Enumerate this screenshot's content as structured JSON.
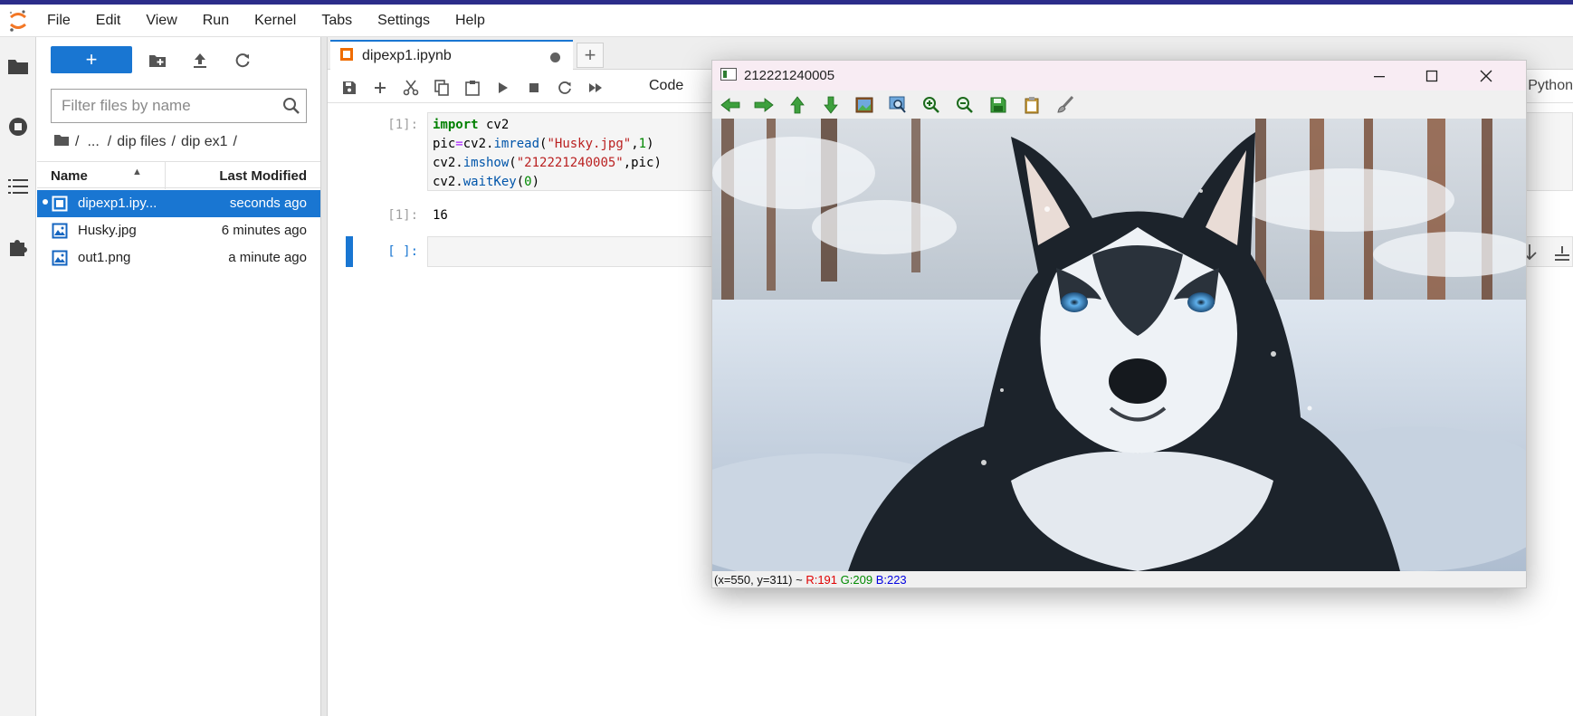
{
  "menu": [
    "File",
    "Edit",
    "View",
    "Run",
    "Kernel",
    "Tabs",
    "Settings",
    "Help"
  ],
  "filebrowser": {
    "new_label": "+",
    "filter_placeholder": "Filter files by name",
    "breadcrumb": [
      "/",
      "...",
      "/",
      "dip files",
      "/",
      "dip ex1",
      "/"
    ],
    "columns": {
      "name": "Name",
      "modified": "Last Modified"
    },
    "files": [
      {
        "name": "dipexp1.ipynb",
        "display": "dipexp1.ipy...",
        "modified": "seconds ago",
        "selected": true,
        "icon": "notebook-icon"
      },
      {
        "name": "Husky.jpg",
        "display": "Husky.jpg",
        "modified": "6 minutes ago",
        "selected": false,
        "icon": "image-file-icon"
      },
      {
        "name": "out1.png",
        "display": "out1.png",
        "modified": "a minute ago",
        "selected": false,
        "icon": "image-file-icon"
      }
    ]
  },
  "notebook": {
    "tab_title": "dipexp1.ipynb",
    "add_tab": "+",
    "cell_type": "Code",
    "kernel": "Python",
    "cells": [
      {
        "prompt": "[1]:",
        "code": [
          "import cv2",
          "pic=cv2.imread(\"Husky.jpg\",1)",
          "cv2.imshow(\"212221240005\",pic)",
          "cv2.waitKey(0)"
        ]
      },
      {
        "output_prompt": "[1]:",
        "output": "16"
      },
      {
        "prompt": "[ ]:",
        "code": []
      }
    ]
  },
  "cvwindow": {
    "title": "212221240005",
    "status": {
      "coords": "(x=550, y=311) ~",
      "r": "R:191",
      "g": "G:209",
      "b": "B:223"
    }
  },
  "colors": {
    "accent": "#1976d2",
    "top_strip": "#2c2d8a",
    "cv_title": "#f8ecf3"
  }
}
